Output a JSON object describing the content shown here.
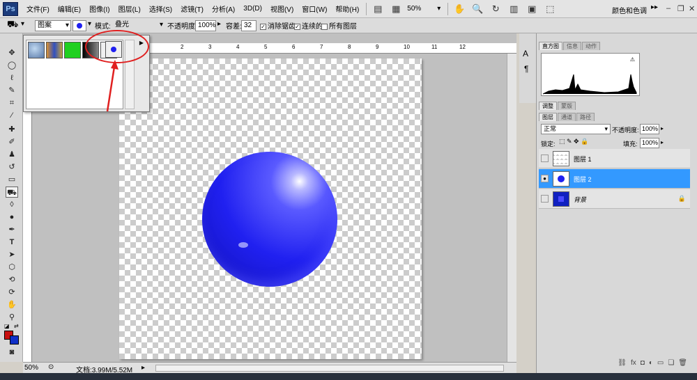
{
  "app": {
    "logo_text": "Ps",
    "menu": [
      "文件(F)",
      "编辑(E)",
      "图像(I)",
      "图层(L)",
      "选择(S)",
      "滤镜(T)",
      "分析(A)",
      "3D(D)",
      "视图(V)",
      "窗口(W)",
      "帮助(H)"
    ],
    "zoom": "50%",
    "workspace": "颜色和色调"
  },
  "options": {
    "fill_source": "图案",
    "mode_label": "模式:",
    "mode_value": "叠光",
    "opacity_label": "不透明度:",
    "opacity_value": "100%",
    "tolerance_label": "容差:",
    "tolerance_value": "32",
    "antialias_label": "消除锯齿",
    "contiguous_label": "连续的",
    "all_layers_label": "所有图层"
  },
  "pattern_picker": {
    "patterns": [
      "bubbles",
      "tie-dye",
      "green",
      "black-gradient",
      "black-sphere",
      "blue-sphere"
    ]
  },
  "ruler": {
    "h_labels": [
      "2",
      "3",
      "4",
      "5",
      "6",
      "7",
      "8",
      "9",
      "10",
      "11",
      "12"
    ]
  },
  "status": {
    "zoom": "50%",
    "doc_info": "文档:3.99M/5.52M"
  },
  "panels": {
    "top_tabs": [
      "直方图",
      "信息",
      "动作"
    ],
    "adjust_tabs": [
      "调整",
      "蒙版"
    ],
    "layer_tabs": [
      "图层",
      "通道",
      "路径"
    ],
    "blend_mode": "正常",
    "opacity_label": "不透明度:",
    "opacity_value": "100%",
    "lock_label": "锁定:",
    "fill_label": "填充:",
    "fill_value": "100%",
    "layers": [
      {
        "name": "图层 1",
        "visible": false,
        "active": false
      },
      {
        "name": "图层 2",
        "visible": true,
        "active": true
      },
      {
        "name": "背景",
        "visible": false,
        "active": false
      }
    ]
  },
  "colors": {
    "sphere": "#2020f0",
    "selection": "#3399ff",
    "foreground": "#c81010",
    "background": "#1030c8",
    "annotation": "#e02020"
  }
}
